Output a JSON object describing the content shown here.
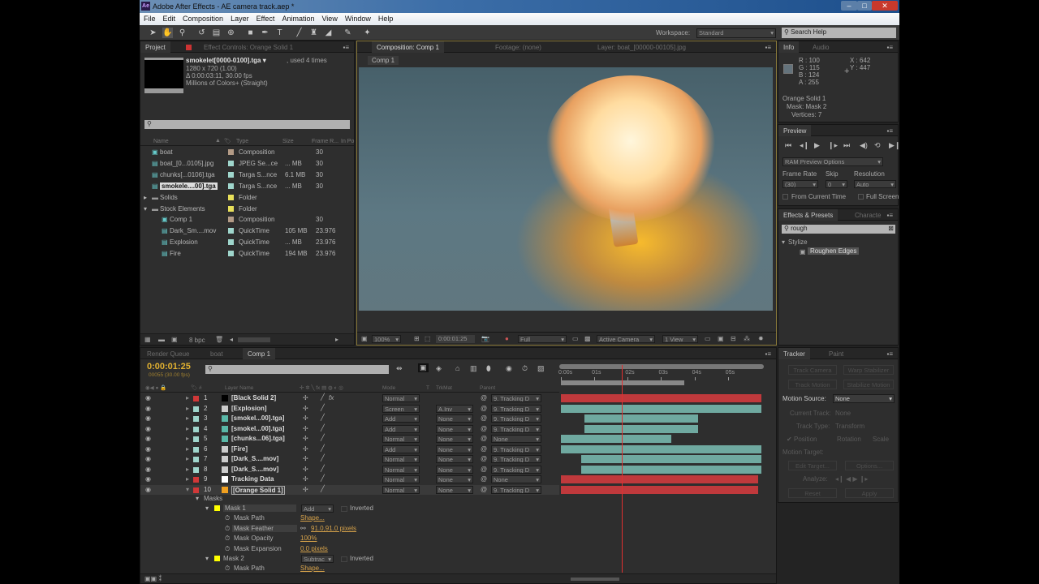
{
  "window": {
    "title": "Adobe After Effects - AE camera track.aep *",
    "logo": "Ae",
    "minimize": "–",
    "maximize": "□",
    "close": "✕"
  },
  "menu": [
    "File",
    "Edit",
    "Composition",
    "Layer",
    "Effect",
    "Animation",
    "View",
    "Window",
    "Help"
  ],
  "toolbar": {
    "tools": [
      "selection-tool",
      "hand-tool",
      "zoom-tool",
      "rotate-tool",
      "camera-tool",
      "pan-behind-tool",
      "rectangle-tool",
      "pen-tool",
      "type-tool",
      "brush-tool",
      "clone-stamp-tool",
      "eraser-tool",
      "roto-brush-tool",
      "puppet-pin-tool"
    ],
    "workspace_label": "Workspace:",
    "workspace_value": "Standard",
    "search_placeholder": "Search Help"
  },
  "project": {
    "tabs": [
      "Project",
      "Effect Controls: Orange Solid 1"
    ],
    "selected_name": "smokelet[0000-0100].tga ▾",
    "used": ", used 4 times",
    "dims": "1280 x 720 (1.00)",
    "duration": "Δ 0:00:03:11, 30.00 fps",
    "colors": "Millions of Colors+ (Straight)",
    "search_placeholder": "",
    "columns": [
      "Name",
      "Type",
      "Size",
      "Frame R...",
      "In Po"
    ],
    "items": [
      {
        "name": "boat",
        "type": "Composition",
        "size": "",
        "fr": "30",
        "label": "#b39b86",
        "indent": 0,
        "kind": "comp"
      },
      {
        "name": "boat_[0...0105].jpg",
        "type": "JPEG Se...ce",
        "size": "... MB",
        "fr": "30",
        "label": "#9fd6cc",
        "indent": 0,
        "kind": "seq"
      },
      {
        "name": "chunks[...0106].tga",
        "type": "Targa S...nce",
        "size": "6.1 MB",
        "fr": "30",
        "label": "#9fd6cc",
        "indent": 0,
        "kind": "seq"
      },
      {
        "name": "smokele....00].tga",
        "type": "Targa S...nce",
        "size": "... MB",
        "fr": "30",
        "label": "#9fd6cc",
        "indent": 0,
        "kind": "seq",
        "selected": true
      },
      {
        "name": "Solids",
        "type": "Folder",
        "size": "",
        "fr": "",
        "label": "#e8e05a",
        "indent": 0,
        "kind": "folder",
        "twirl": "▸"
      },
      {
        "name": "Stock Elements",
        "type": "Folder",
        "size": "",
        "fr": "",
        "label": "#e8e05a",
        "indent": 0,
        "kind": "folder",
        "twirl": "▾"
      },
      {
        "name": "Comp 1",
        "type": "Composition",
        "size": "",
        "fr": "30",
        "label": "#b39b86",
        "indent": 1,
        "kind": "comp"
      },
      {
        "name": "Dark_Sm....mov",
        "type": "QuickTime",
        "size": "105 MB",
        "fr": "23.976",
        "label": "#9fd6cc",
        "indent": 1,
        "kind": "file"
      },
      {
        "name": "Explosion",
        "type": "QuickTime",
        "size": "... MB",
        "fr": "23.976",
        "label": "#9fd6cc",
        "indent": 1,
        "kind": "file"
      },
      {
        "name": "Fire",
        "type": "QuickTime",
        "size": "194 MB",
        "fr": "23.976",
        "label": "#9fd6cc",
        "indent": 1,
        "kind": "file"
      }
    ],
    "bpc": "8 bpc"
  },
  "composition": {
    "tabs": [
      "Composition: Comp 1",
      "Footage: (none)",
      "Layer: boat_[00000-00105].jpg"
    ],
    "breadcrumb": "Comp 1",
    "zoom": "100%",
    "timecode": "0:00:01:25",
    "resolution": "Full",
    "camera": "Active Camera",
    "views": "1 View"
  },
  "info": {
    "tabs": [
      "Info",
      "Audio"
    ],
    "r": "R : 100",
    "g": "G : 115",
    "b": "B : 124",
    "a": "A : 255",
    "x": "X : 642",
    "y": "Y : 447",
    "swatch": "#64737c",
    "layer": "Orange Solid 1",
    "mask": "Mask: Mask 2",
    "vertices": "Vertices: 7"
  },
  "preview": {
    "tab": "Preview",
    "ram": "RAM Preview Options",
    "frame_rate_label": "Frame Rate",
    "skip_label": "Skip",
    "resolution_label": "Resolution",
    "frame_rate": "(30)",
    "skip": "0",
    "resolution": "Auto",
    "from_current": "From Current Time",
    "full_screen": "Full Screen"
  },
  "effects": {
    "tabs": [
      "Effects & Presets",
      "Characte"
    ],
    "search": "rough",
    "category": "Stylize",
    "item": "Roughen Edges"
  },
  "timeline": {
    "tabs": [
      "Render Queue",
      "boat",
      "Comp 1"
    ],
    "timecode": "0:00:01:25",
    "frame_info": "00055 (30.00 fps)",
    "columns": {
      "name": "Layer Name",
      "mode": "Mode",
      "t": "T",
      "trkmat": "TrkMat",
      "parent": "Parent"
    },
    "ruler": [
      "0:00s",
      "01s",
      "02s",
      "03s",
      "04s",
      "05s"
    ],
    "current_time_s": 1.83,
    "duration_s": 6,
    "layers": [
      {
        "num": "1",
        "name": "[Black Solid 2]",
        "label": "#d03838",
        "swatch": "#000",
        "mode": "Normal",
        "trkmat": "",
        "parent": "9. Tracking D",
        "fx": "fx",
        "bar": "#c0393c",
        "start": 0,
        "end": 6
      },
      {
        "num": "2",
        "name": "[Explosion]",
        "label": "#9fd6cc",
        "swatch": "#ccc",
        "mode": "Screen",
        "trkmat": "A.Inv",
        "parent": "9. Tracking D",
        "bar": "#6fa9a0",
        "start": 0,
        "end": 6
      },
      {
        "num": "3",
        "name": "[smokel...00].tga]",
        "label": "#9fd6cc",
        "swatch": "#5ab8a8",
        "mode": "Add",
        "trkmat": "None",
        "parent": "9. Tracking D",
        "bar": "#6fa9a0",
        "start": 0.7,
        "end": 4.1
      },
      {
        "num": "4",
        "name": "[smokel...00].tga]",
        "label": "#9fd6cc",
        "swatch": "#5ab8a8",
        "mode": "Add",
        "trkmat": "None",
        "parent": "9. Tracking D",
        "bar": "#6fa9a0",
        "start": 0.7,
        "end": 4.1
      },
      {
        "num": "5",
        "name": "[chunks...06].tga]",
        "label": "#9fd6cc",
        "swatch": "#5ab8a8",
        "mode": "Normal",
        "trkmat": "None",
        "parent": "None",
        "bar": "#6fa9a0",
        "start": 0,
        "end": 3.3
      },
      {
        "num": "6",
        "name": "[Fire]",
        "label": "#9fd6cc",
        "swatch": "#ccc",
        "mode": "Add",
        "trkmat": "None",
        "parent": "9. Tracking D",
        "bar": "#6fa9a0",
        "start": 0,
        "end": 6
      },
      {
        "num": "7",
        "name": "[Dark_S....mov]",
        "label": "#9fd6cc",
        "swatch": "#ccc",
        "mode": "Normal",
        "trkmat": "None",
        "parent": "9. Tracking D",
        "bar": "#6fa9a0",
        "start": 0.6,
        "end": 6
      },
      {
        "num": "8",
        "name": "[Dark_S....mov]",
        "label": "#9fd6cc",
        "swatch": "#ccc",
        "mode": "Normal",
        "trkmat": "None",
        "parent": "9. Tracking D",
        "bar": "#6fa9a0",
        "start": 0.6,
        "end": 6
      },
      {
        "num": "9",
        "name": "Tracking Data",
        "label": "#d03838",
        "swatch": "#fff",
        "mode": "Normal",
        "trkmat": "None",
        "parent": "None",
        "bar": "#c0393c",
        "start": 0,
        "end": 5.9
      },
      {
        "num": "10",
        "name": "[Orange Solid 1]",
        "label": "#d03838",
        "swatch": "#f0a020",
        "mode": "Normal",
        "trkmat": "None",
        "parent": "9. Tracking D",
        "bar": "#c0393c",
        "start": 0,
        "end": 5.9,
        "selected": true,
        "open": true
      }
    ],
    "masks": {
      "group": "Masks",
      "mask1": "Mask 1",
      "mask1_mode": "Add",
      "inverted": "Inverted",
      "path": "Mask Path",
      "path_val": "Shape...",
      "feather": "Mask Feather",
      "feather_val": "91.0,91.0 pixels",
      "opacity": "Mask Opacity",
      "opacity_val": "100%",
      "expansion": "Mask Expansion",
      "expansion_val": "0.0 pixels",
      "mask2": "Mask 2",
      "mask2_mode": "Subtrac",
      "path2": "Mask Path",
      "path2_val": "Shape..."
    }
  },
  "tracker": {
    "tabs": [
      "Tracker",
      "Paint"
    ],
    "track_camera": "Track Camera",
    "warp": "Warp Stabilizer",
    "track_motion": "Track Motion",
    "stabilize": "Stabilize Motion",
    "motion_source_label": "Motion Source:",
    "motion_source": "None",
    "current_track_label": "Current Track:",
    "current_track": "None",
    "track_type_label": "Track Type:",
    "track_type": "Transform",
    "position": "Position",
    "rotation": "Rotation",
    "scale": "Scale",
    "motion_target": "Motion Target:",
    "edit_target": "Edit Target...",
    "options": "Options...",
    "analyze": "Analyze:",
    "reset": "Reset",
    "apply": "Apply"
  }
}
